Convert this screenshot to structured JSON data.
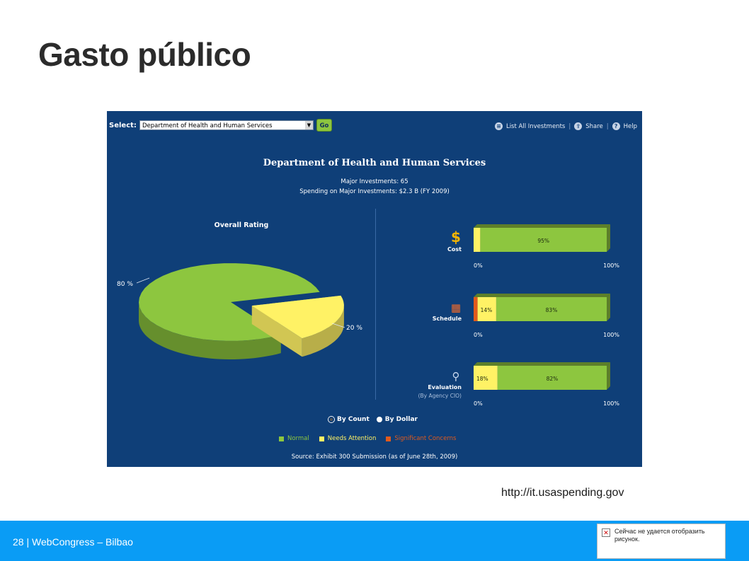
{
  "slide": {
    "title": "Gasto público",
    "source_url": "http://it.usaspending.gov",
    "footer": "28 | WebCongress – Bilbao",
    "broken_image_text": "Сейчас не удается отобразить рисунок."
  },
  "panel": {
    "select_label": "Select:",
    "select_value": "Department of Health and Human Services",
    "go_label": "Go",
    "tools": [
      "List All Investments",
      "Share",
      "Help"
    ],
    "heading": "Department of Health and Human Services",
    "major_investments": "Major Investments: 65",
    "spending": "Spending on Major Investments: $2.3 B (FY 2009)",
    "radio_options": [
      "By Count",
      "By Dollar"
    ],
    "legend": [
      {
        "label": "Normal",
        "color": "#8dc63f"
      },
      {
        "label": "Needs Attention",
        "color": "#fff265"
      },
      {
        "label": "Significant Concerns",
        "color": "#e15a1c"
      }
    ],
    "source": "Source: Exhibit 300 Submission (as of June 28th, 2009)"
  },
  "chart_data": [
    {
      "type": "pie",
      "title": "Overall Rating",
      "categories": [
        "Normal",
        "Needs Attention"
      ],
      "values": [
        80,
        20
      ],
      "data_labels": [
        "80 %",
        "20 %"
      ],
      "colors": [
        "#8dc63f",
        "#fff265"
      ]
    },
    {
      "type": "bar",
      "stacked": true,
      "orientation": "horizontal",
      "categories": [
        "Cost",
        "Schedule",
        "Evaluation"
      ],
      "category_subtitles": [
        "",
        "",
        "(By Agency CIO)"
      ],
      "series": [
        {
          "name": "Significant Concerns",
          "values": [
            0,
            3,
            0
          ],
          "labels": [
            "",
            "",
            ""
          ]
        },
        {
          "name": "Needs Attention",
          "values": [
            5,
            14,
            18
          ],
          "labels": [
            "",
            "14%",
            "18%"
          ]
        },
        {
          "name": "Normal",
          "values": [
            95,
            83,
            82
          ],
          "labels": [
            "95%",
            "83%",
            "82%"
          ]
        }
      ],
      "axis_tick_labels": [
        "0%",
        "100%"
      ],
      "xlim": [
        0,
        100
      ]
    }
  ]
}
